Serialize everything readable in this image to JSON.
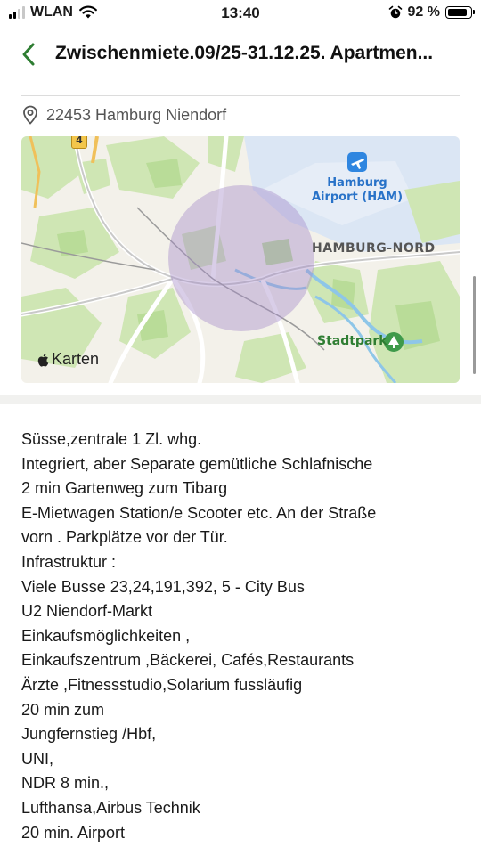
{
  "status_bar": {
    "carrier": "WLAN",
    "time": "13:40",
    "battery_percent": "92 %",
    "battery_level": 0.92,
    "signal_bars_active": 2
  },
  "nav": {
    "title": "Zwischenmiete.09/25-31.12.25. Apartmen...",
    "back_icon": "chevron-left-icon",
    "accent_color": "#2e7d32"
  },
  "location": {
    "icon": "map-pin-icon",
    "text": "22453 Hamburg Niendorf"
  },
  "map": {
    "labels": {
      "airport_line1": "Hamburg",
      "airport_line2": "Airport (HAM)",
      "district": "HAMBURG-NORD",
      "park": "Stadtpark",
      "road_badge": "4",
      "attribution": "Karten"
    }
  },
  "description": {
    "lines": [
      "Süsse,zentrale 1 Zl. whg.",
      "Integriert, aber Separate gemütliche Schlafnische",
      "2 min Gartenweg zum Tibarg",
      "E-Mietwagen Station/e Scooter etc. An der Straße",
      "vorn . Parkplätze vor der Tür.",
      "Infrastruktur :",
      "Viele Busse 23,24,191,392, 5 - City Bus",
      "U2 Niendorf-Markt",
      "Einkaufsmöglichkeiten ,",
      "Einkaufszentrum ,Bäckerei, Cafés,Restaurants",
      "Ärzte ,Fitnessstudio,Solarium fussläufig",
      "20 min zum",
      "Jungfernstieg /Hbf,",
      "UNI,",
      "NDR 8 min.,",
      "Lufthansa,Airbus Technik",
      "20 min. Airport"
    ]
  }
}
